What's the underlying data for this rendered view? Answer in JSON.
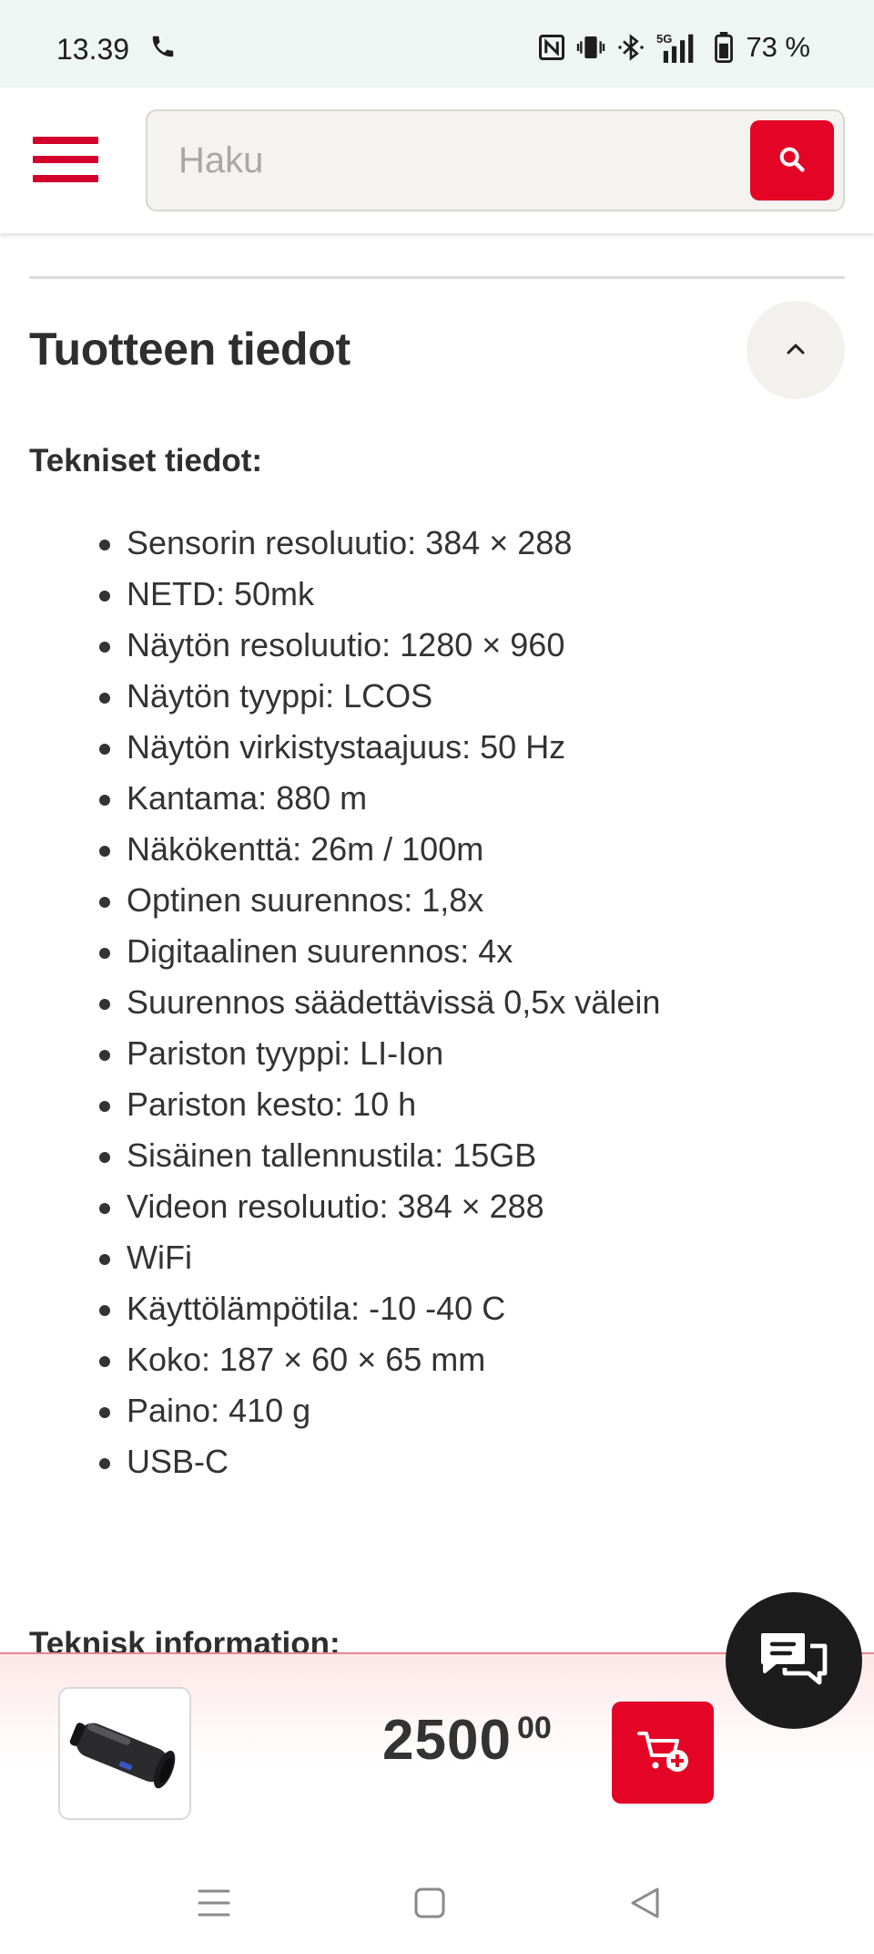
{
  "status_bar": {
    "time": "13.39",
    "battery": "73 %",
    "icons": [
      "phone-call-icon",
      "nfc-icon",
      "vibrate-icon",
      "bluetooth-icon",
      "5g-signal-icon",
      "battery-icon"
    ]
  },
  "header": {
    "menu_icon": "hamburger-menu-icon",
    "search": {
      "placeholder": "Haku",
      "value": "",
      "button_icon": "search-icon"
    }
  },
  "colors": {
    "accent": "#e30426",
    "menu": "#d2002b",
    "text": "#333333",
    "chat": "#1c1c1c"
  },
  "section": {
    "title": "Tuotteen tiedot",
    "collapse_icon": "chevron-up-icon",
    "subheading": "Tekniset tiedot:",
    "specs": [
      "Sensorin resoluutio: 384 × 288",
      "NETD: 50mk",
      "Näytön resoluutio: 1280 × 960",
      "Näytön tyyppi: LCOS",
      "Näytön virkistystaajuus: 50 Hz",
      "Kantama: 880 m",
      "Näkökenttä: 26m / 100m",
      "Optinen suurennos: 1,8x",
      "Digitaalinen suurennos: 4x",
      "Suurennos säädettävissä 0,5x välein",
      "Pariston tyyppi: LI-Ion",
      "Pariston kesto: 10 h",
      "Sisäinen tallennustila: 15GB",
      "Videon resoluutio: 384 × 288",
      "WiFi",
      "Käyttölämpötila: -10 -40 C",
      "Koko: 187 × 60 × 65 mm",
      "Paino: 410 g",
      "USB-C"
    ],
    "next_heading": "Teknisk information:"
  },
  "bottom_bar": {
    "product_image_icon": "thermal-monocular-product-image",
    "price_main": "2500",
    "price_cents": "00",
    "cart_icon": "add-to-cart-icon",
    "chat_icon": "chat-bubbles-icon"
  },
  "nav_bar": {
    "items": [
      "recent-apps-icon",
      "home-icon",
      "back-icon"
    ]
  }
}
